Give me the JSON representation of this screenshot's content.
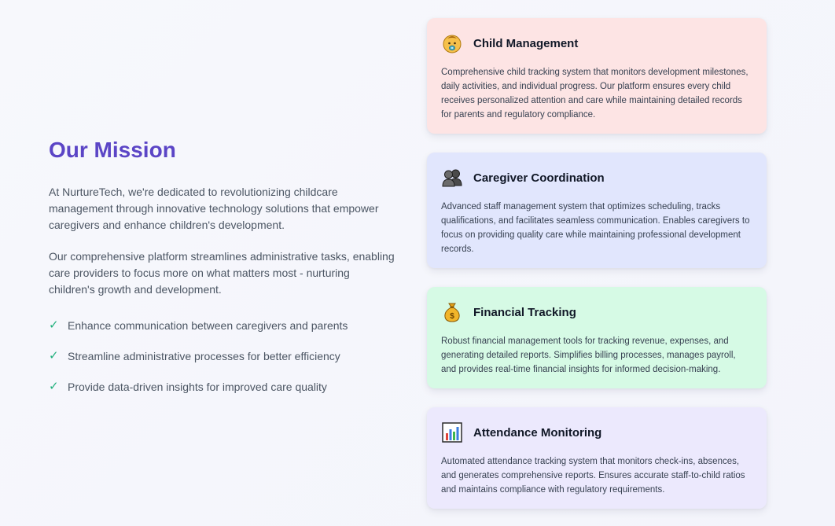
{
  "mission": {
    "title": "Our Mission",
    "paragraph1": "At NurtureTech, we're dedicated to revolutionizing childcare management through innovative technology solutions that empower caregivers and enhance children's development.",
    "paragraph2": "Our comprehensive platform streamlines administrative tasks, enabling care providers to focus more on what matters most - nurturing children's growth and development.",
    "check_symbol": "✓",
    "checklist": [
      "Enhance communication between caregivers and parents",
      "Streamline administrative processes for better efficiency",
      "Provide data-driven insights for improved care quality"
    ]
  },
  "features": [
    {
      "icon": "baby-face-icon",
      "title": "Child Management",
      "description": "Comprehensive child tracking system that monitors development milestones, daily activities, and individual progress. Our platform ensures every child receives personalized attention and care while maintaining detailed records for parents and regulatory compliance.",
      "color": "#fde4e4"
    },
    {
      "icon": "people-silhouette-icon",
      "title": "Caregiver Coordination",
      "description": "Advanced staff management system that optimizes scheduling, tracks qualifications, and facilitates seamless communication. Enables caregivers to focus on providing quality care while maintaining professional development records.",
      "color": "#e1e6fd"
    },
    {
      "icon": "money-bag-icon",
      "title": "Financial Tracking",
      "description": "Robust financial management tools for tracking revenue, expenses, and generating detailed reports. Simplifies billing processes, manages payroll, and provides real-time financial insights for informed decision-making.",
      "color": "#d6fae5"
    },
    {
      "icon": "bar-chart-icon",
      "title": "Attendance Monitoring",
      "description": "Automated attendance tracking system that monitors check-ins, absences, and generates comprehensive reports. Ensures accurate staff-to-child ratios and maintains compliance with regulatory requirements.",
      "color": "#ece9fd"
    }
  ],
  "colors": {
    "accent": "#5b45c6",
    "check": "#22b07d"
  }
}
